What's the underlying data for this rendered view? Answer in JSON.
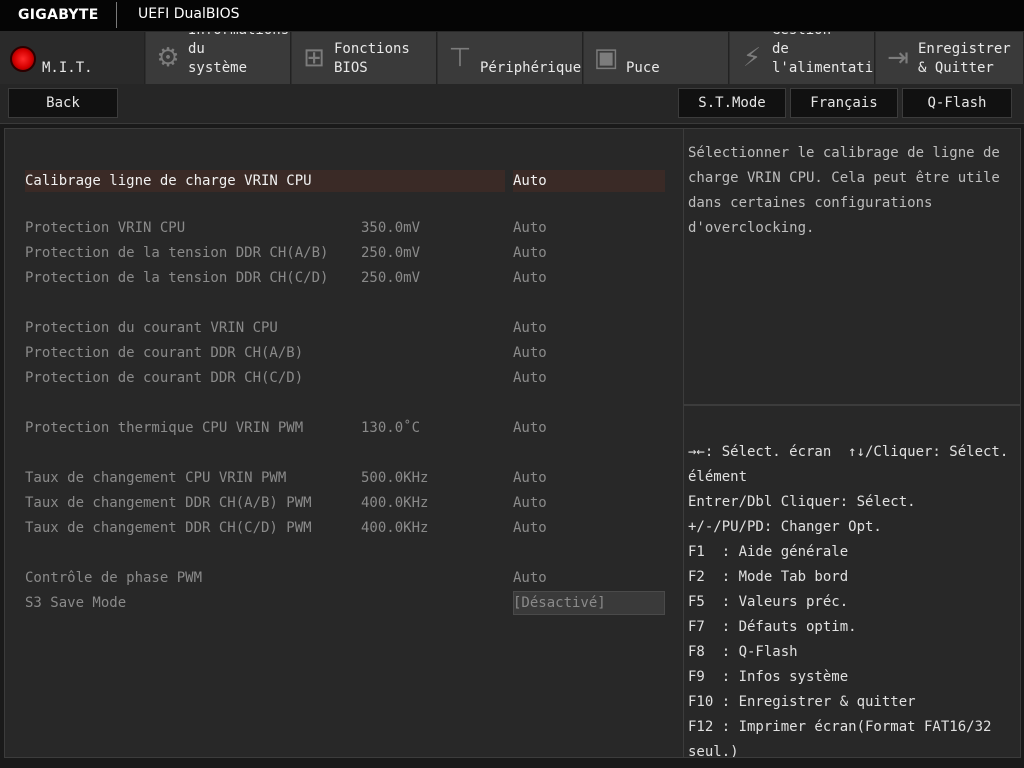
{
  "brand": "GIGABYTE",
  "bios_title": "UEFI DualBIOS",
  "tabs": [
    {
      "label": "M.I.T.",
      "icon": "mit-red-dot-icon"
    },
    {
      "label": "Informations\ndu\nsystème",
      "icon": "gear-icon"
    },
    {
      "label": "Fonctions\nBIOS",
      "icon": "chip-plus-icon"
    },
    {
      "label": "Périphériques",
      "icon": "plug-icon"
    },
    {
      "label": "Puce",
      "icon": "chip-icon"
    },
    {
      "label": "Gestion\nde\nl'alimentation",
      "icon": "power-icon"
    },
    {
      "label": "Enregistrer\n& Quitter",
      "icon": "exit-icon"
    }
  ],
  "buttons": {
    "back": "Back",
    "st_mode": "S.T.Mode",
    "language": "Français",
    "qflash": "Q-Flash"
  },
  "settings": [
    {
      "label": "Calibrage ligne de charge VRIN CPU",
      "current": "",
      "value": "Auto"
    },
    {
      "label": "Protection VRIN CPU",
      "current": "350.0mV",
      "value": "Auto"
    },
    {
      "label": "Protection de la tension DDR CH(A/B)",
      "current": "250.0mV",
      "value": "Auto"
    },
    {
      "label": "Protection de la tension DDR CH(C/D)",
      "current": "250.0mV",
      "value": "Auto"
    },
    {
      "label": "Protection du courant VRIN CPU",
      "current": "",
      "value": "Auto"
    },
    {
      "label": "Protection de courant DDR CH(A/B)",
      "current": "",
      "value": "Auto"
    },
    {
      "label": "Protection de courant DDR CH(C/D)",
      "current": "",
      "value": "Auto"
    },
    {
      "label": "Protection thermique CPU VRIN PWM",
      "current": "130.0˚C",
      "value": "Auto"
    },
    {
      "label": "Taux de changement CPU VRIN PWM",
      "current": "500.0KHz",
      "value": "Auto"
    },
    {
      "label": "Taux de changement DDR CH(A/B) PWM",
      "current": "400.0KHz",
      "value": "Auto"
    },
    {
      "label": "Taux de changement DDR CH(C/D) PWM",
      "current": "400.0KHz",
      "value": "Auto"
    },
    {
      "label": "Contrôle de phase PWM",
      "current": "",
      "value": "Auto"
    },
    {
      "label": "S3 Save Mode",
      "current": "",
      "value": "[Désactivé]"
    }
  ],
  "help_text": "Sélectionner le calibrage de ligne de\ncharge VRIN CPU. Cela peut être utile\ndans certaines configurations\nd'overclocking.",
  "key_help": [
    "→←: Sélect. écran  ↑↓/Cliquer: Sélect.",
    "élément",
    "Entrer/Dbl Cliquer: Sélect.",
    "+/-/PU/PD: Changer Opt.",
    "F1  : Aide générale",
    "F2  : Mode Tab bord",
    "F5  : Valeurs préc.",
    "F7  : Défauts optim.",
    "F8  : Q-Flash",
    "F9  : Infos système",
    "F10 : Enregistrer & quitter",
    "F12 : Imprimer écran(Format FAT16/32",
    "seul.)"
  ],
  "colors": {
    "selected_row": "#3a2a26",
    "mit_accent": "#e00000"
  }
}
